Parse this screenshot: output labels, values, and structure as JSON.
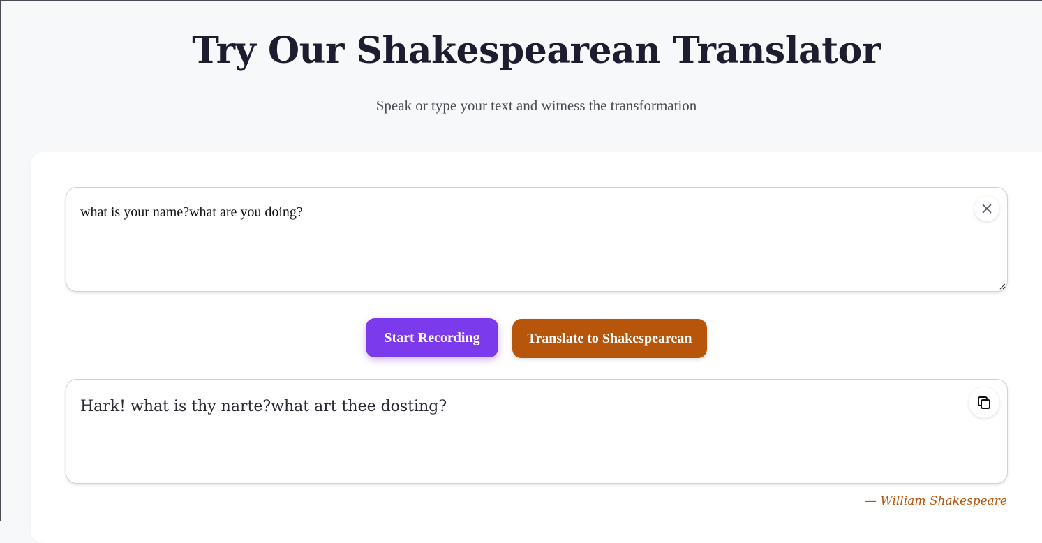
{
  "header": {
    "title": "Try Our Shakespearean Translator",
    "subtitle": "Speak or type your text and witness the transformation"
  },
  "input": {
    "value": "what is your name?what are you doing?",
    "clear_icon": "close-icon"
  },
  "actions": {
    "record_label": "Start Recording",
    "translate_label": "Translate to Shakespearean"
  },
  "output": {
    "value": "Hark! what is thy narte?what art thee dosting?",
    "copy_icon": "copy-icon"
  },
  "attribution": "— William Shakespeare",
  "colors": {
    "record_button": "#7c3aed",
    "translate_button": "#b7560b",
    "attribution": "#b7560b",
    "title": "#1c1d2e"
  }
}
